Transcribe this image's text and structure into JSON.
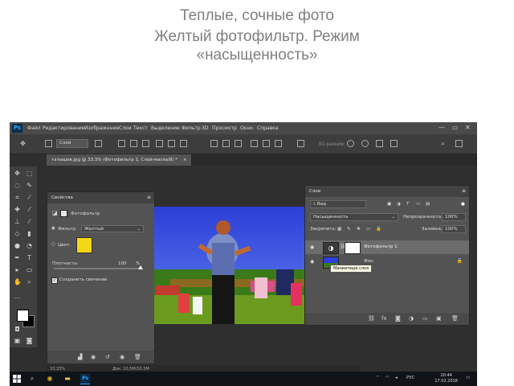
{
  "slide": {
    "line1": "Теплые, сочные фото",
    "line2": "Желтый фотофильтр. Режим",
    "line3": "«насыщенность»"
  },
  "app": {
    "logo": "Ps",
    "menu": [
      "Файл",
      "Редактирование",
      "Изображение",
      "Слои",
      "Текст",
      "Выделение",
      "Фильтр",
      "3D",
      "Просмотр",
      "Окно",
      "Справка"
    ],
    "window_controls": [
      "—",
      "▭",
      "✕"
    ]
  },
  "options_bar": {
    "layer_select": "Слой",
    "mode_3d": "3D-режим:"
  },
  "document_tab": {
    "label": "татышев.jpg @ 33,3% (Фотофильтр 1, Слой-маска/8) *",
    "close": "×"
  },
  "properties_panel": {
    "title": "Свойства",
    "adjustment_name": "Фотофильтр",
    "filter_label": "Фильтр:",
    "filter_value": "Желтый",
    "color_label": "Цвет:",
    "color_hex": "#f5d715",
    "density_label": "Плотность:",
    "density_value": "100",
    "density_unit": "%",
    "density_fraction": 1.0,
    "preserve_luminosity_label": "Сохранить свечение",
    "preserve_luminosity_checked": true
  },
  "status_bar": {
    "zoom": "33,33%",
    "doc_size": "Док: 10,5M/10,5M"
  },
  "layers_panel": {
    "title": "Слои",
    "filter_kind": "Вид",
    "blend_mode": "Насыщенность",
    "opacity_label": "Непрозрачность:",
    "opacity_value": "100%",
    "lock_label": "Закрепить:",
    "fill_label": "Заливка:",
    "fill_value": "100%",
    "layers": [
      {
        "name": "Фотофильтр 1",
        "visible": true,
        "selected": true
      },
      {
        "name": "Фон",
        "visible": true,
        "selected": false
      }
    ],
    "tooltip": "Миниатюра слоя"
  },
  "taskbar": {
    "language": "РУС",
    "time": "20:44",
    "date": "17.02.2018"
  },
  "colors": {
    "panel": "#535353",
    "workspace": "#2f2f2f",
    "swatch_yellow": "#f5d715",
    "ps_blue": "#31a8ff"
  }
}
